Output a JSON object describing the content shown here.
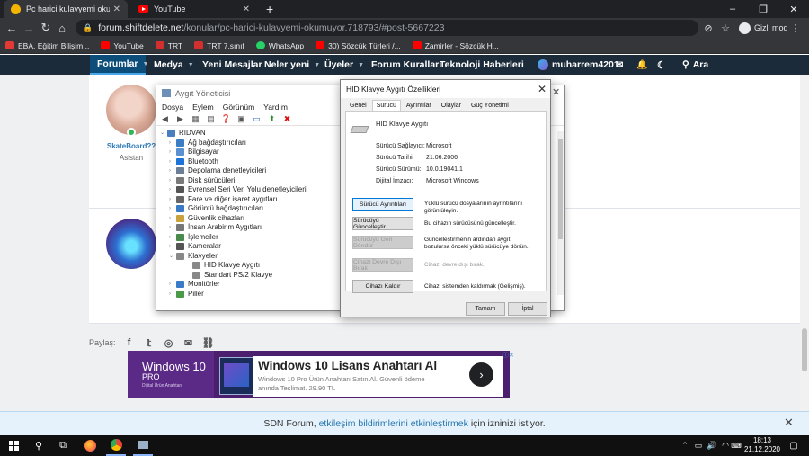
{
  "browser": {
    "tabs": [
      {
        "title": "Pc harici kulavyemi okumuyor | ShiftDelete.Net",
        "active": true
      },
      {
        "title": "YouTube",
        "active": false
      }
    ],
    "new_tab": "+",
    "url_host": "forum.shiftdelete.net",
    "url_path": "/konular/pc-harici-kulavyemi-okumuyor.718793/#post-5667223",
    "incognito_label": "Gizli mod",
    "bookmarks": [
      {
        "label": "EBA, Eğitim Bilişim...",
        "color": "#e53935"
      },
      {
        "label": "YouTube",
        "color": "#ff0000"
      },
      {
        "label": "TRT",
        "color": "#d32f2f"
      },
      {
        "label": "TRT 7.sınıf",
        "color": "#d32f2f"
      },
      {
        "label": "WhatsApp",
        "color": "#25d366"
      },
      {
        "label": "30) Sözcük Türleri /...",
        "color": "#ff0000"
      },
      {
        "label": "Zamirler - Sözcük H...",
        "color": "#ff0000"
      }
    ]
  },
  "forum": {
    "nav": [
      "Forumlar",
      "Medya",
      "Yeni Mesajlar",
      "Neler yeni",
      "Üyeler",
      "Forum Kuralları",
      "Teknoloji Haberleri"
    ],
    "username": "muharrem4201",
    "search": "Ara",
    "post_user": {
      "name": "SkateBoard??",
      "role": "Asistan"
    },
    "share_label": "Paylaş:",
    "ad": {
      "brand": "Windows 10",
      "edition": "PRO",
      "brand_sub": "Dijital Ürün Anahtarı",
      "title": "Windows 10 Lisans Anahtarı Al",
      "desc": "Windows 10 Pro Ürün Anahtarı Satın Al. Güvenli ödeme anında Teslimat. 29.90 TL"
    },
    "notification": {
      "prefix": "SDN Forum,",
      "link": "etkileşim bildirimlerini etkinleştirmek",
      "suffix": "için izninizi istiyor."
    }
  },
  "device_manager": {
    "title": "Aygıt Yöneticisi",
    "menu": [
      "Dosya",
      "Eylem",
      "Görünüm",
      "Yardım"
    ],
    "root": "RIDVAN",
    "items": [
      {
        "label": "Ağ bağdaştırıcıları",
        "color": "#3d7dc4",
        "exp": "›",
        "indent": 1
      },
      {
        "label": "Bilgisayar",
        "color": "#5a8fd0",
        "exp": "›",
        "indent": 1
      },
      {
        "label": "Bluetooth",
        "color": "#1e73d8",
        "exp": "›",
        "indent": 1
      },
      {
        "label": "Depolama denetleyicileri",
        "color": "#6d7f96",
        "exp": "›",
        "indent": 1
      },
      {
        "label": "Disk sürücüleri",
        "color": "#7a7a7a",
        "exp": "›",
        "indent": 1
      },
      {
        "label": "Evrensel Seri Veri Yolu denetleyicileri",
        "color": "#555555",
        "exp": "›",
        "indent": 1
      },
      {
        "label": "Fare ve diğer işaret aygıtları",
        "color": "#666666",
        "exp": "›",
        "indent": 1
      },
      {
        "label": "Görüntü bağdaştırıcıları",
        "color": "#3a7bc8",
        "exp": "›",
        "indent": 1
      },
      {
        "label": "Güvenlik cihazları",
        "color": "#c9a23c",
        "exp": "›",
        "indent": 1
      },
      {
        "label": "İnsan Arabirim Aygıtları",
        "color": "#777777",
        "exp": "›",
        "indent": 1
      },
      {
        "label": "İşlemciler",
        "color": "#4a8a4a",
        "exp": "›",
        "indent": 1
      },
      {
        "label": "Kameralar",
        "color": "#555555",
        "exp": "›",
        "indent": 1
      },
      {
        "label": "Klavyeler",
        "color": "#888888",
        "exp": "⌄",
        "indent": 1
      },
      {
        "label": "HID Klavye Aygıtı",
        "color": "#888888",
        "exp": "",
        "indent": 2
      },
      {
        "label": "Standart PS/2 Klavye",
        "color": "#888888",
        "exp": "",
        "indent": 2
      },
      {
        "label": "Monitörler",
        "color": "#3a7bc8",
        "exp": "›",
        "indent": 1
      },
      {
        "label": "Piller",
        "color": "#4a9a4a",
        "exp": "›",
        "indent": 1
      }
    ]
  },
  "hid_dialog": {
    "title": "HID Klavye Aygıtı Özellikleri",
    "tabs": [
      "Genel",
      "Sürücü",
      "Ayrıntılar",
      "Olaylar",
      "Güç Yönetimi"
    ],
    "selected_tab": "Sürücü",
    "device_name": "HID Klavye Aygıtı",
    "props": [
      {
        "label": "Sürücü Sağlayıcı:",
        "value": "Microsoft"
      },
      {
        "label": "Sürücü Tarihi:",
        "value": "21.06.2006"
      },
      {
        "label": "Sürücü Sürümü:",
        "value": "10.0.19041.1"
      },
      {
        "label": "Dijital İmzacı:",
        "value": "Microsoft Windows"
      }
    ],
    "actions": [
      {
        "button": "Sürücü Ayrıntıları",
        "desc": "Yüklü sürücü dosyalarının ayrıntılarını görüntüleyin.",
        "enabled": true
      },
      {
        "button": "Sürücüyü Güncelleştir",
        "desc": "Bu cihazın sürücüsünü güncelleştir.",
        "enabled": true
      },
      {
        "button": "Sürücüyü Geri Döndür",
        "desc": "Güncelleştirmenin ardından aygıt bozulursa önceki yüklü sürücüye dönün.",
        "enabled": false
      },
      {
        "button": "Cihazı Devre Dışı Bırak",
        "desc": "Cihazı devre dışı bırak.",
        "enabled": false
      },
      {
        "button": "Cihazı Kaldır",
        "desc": "Cihazı sistemden kaldırmak (Gelişmiş).",
        "enabled": true
      }
    ],
    "ok": "Tamam",
    "cancel": "İptal"
  },
  "taskbar": {
    "time": "18:13",
    "date": "21.12.2020"
  }
}
